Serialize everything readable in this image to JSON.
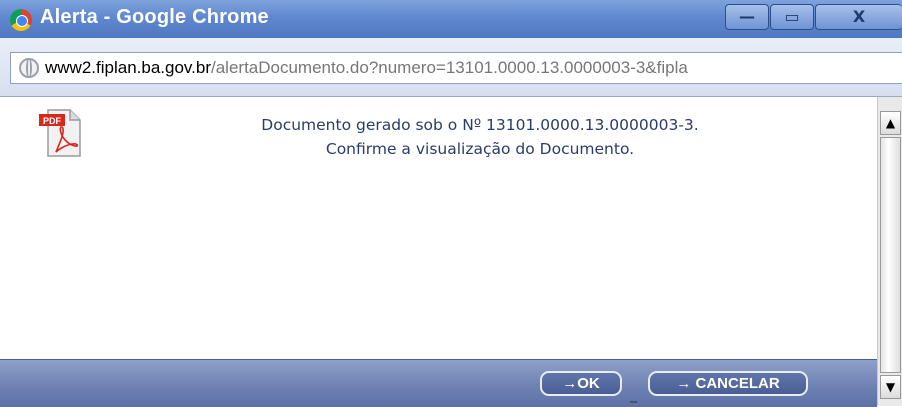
{
  "window": {
    "title": "Alerta - Google Chrome",
    "min_glyph": "—",
    "max_glyph": "▭",
    "close_glyph": "X"
  },
  "address": {
    "host": "www2.fiplan.ba.gov.br",
    "path": "/alertaDocumento.do?numero=13101.0000.13.0000003-3&fipla"
  },
  "message": {
    "line1": "Documento gerado sob o Nº 13101.0000.13.0000003-3.",
    "line2": "Confirme a visualização do Documento."
  },
  "icons": {
    "pdf_label": "PDF"
  },
  "buttons": {
    "ok": "→OK",
    "cancel": "→ CANCELAR",
    "separator": "_"
  },
  "scrollbar": {
    "up": "▲",
    "down": "▼"
  },
  "colors": {
    "titlebar": "#5f88cf",
    "footer": "#6f82b3",
    "message_text": "#2b3b6a"
  }
}
